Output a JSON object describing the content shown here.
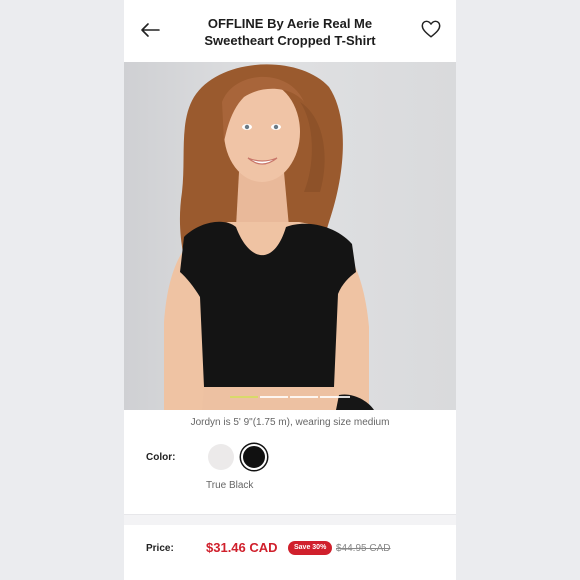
{
  "header": {
    "title_line1": "OFFLINE By Aerie Real Me",
    "title_line2": "Sweetheart Cropped T-Shirt",
    "back_icon": "arrow-left-icon",
    "favorite_icon": "heart-outline-icon"
  },
  "gallery": {
    "image_alt": "Model wearing black sweetheart cropped t-shirt",
    "page_indicator": {
      "current": 1,
      "total": 4
    }
  },
  "model_note": "Jordyn is 5' 9\"(1.75 m), wearing size medium",
  "color": {
    "label": "Color:",
    "options": [
      {
        "name": "White",
        "hex": "#eceaea"
      },
      {
        "name": "True Black",
        "hex": "#111111"
      }
    ],
    "selected_name": "True Black"
  },
  "pricing": {
    "label": "Price:",
    "current": "$31.46 CAD",
    "badge": "Save 30%",
    "original": "$44.95 CAD"
  },
  "colors": {
    "sale_red": "#d0202c",
    "muted_text": "#666666"
  }
}
